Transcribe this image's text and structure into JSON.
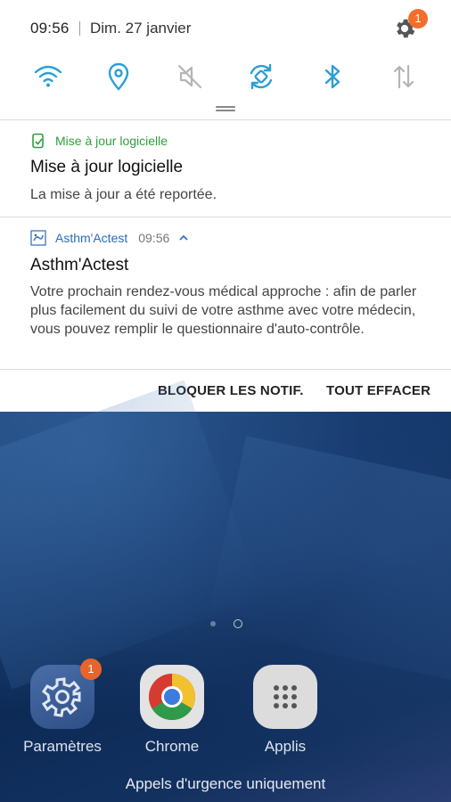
{
  "status_bar": {
    "time": "09:56",
    "date": "Dim. 27 janvier",
    "settings_badge": "1"
  },
  "quick_settings": [
    {
      "name": "wifi",
      "icon": "wifi-icon",
      "active": true
    },
    {
      "name": "location",
      "icon": "location-icon",
      "active": true
    },
    {
      "name": "sound",
      "icon": "mute-icon",
      "active": false
    },
    {
      "name": "auto-rotate",
      "icon": "rotate-icon",
      "active": true
    },
    {
      "name": "bluetooth",
      "icon": "bluetooth-icon",
      "active": true
    },
    {
      "name": "mobile-data",
      "icon": "data-transfer-icon",
      "active": false
    }
  ],
  "notifications": [
    {
      "app": "Mise à jour logicielle",
      "title": "Mise à jour logicielle",
      "text": "La mise à jour a été reportée."
    },
    {
      "app": "Asthm'Actest",
      "time": "09:56",
      "title": "Asthm'Actest",
      "text": "Votre prochain rendez-vous médical approche : afin de parler plus facilement du suivi de votre asthme avec votre médecin, vous pouvez remplir le questionnaire d'auto-contrôle."
    }
  ],
  "actions": {
    "block": "BLOQUER LES NOTIF.",
    "clear": "TOUT EFFACER"
  },
  "home": {
    "apps": [
      {
        "label": "Paramètres",
        "badge": "1"
      },
      {
        "label": "Chrome"
      },
      {
        "label": "Applis"
      }
    ],
    "emergency": "Appels d'urgence uniquement"
  },
  "colors": {
    "accent": "#2a9fd6",
    "inactive": "#b5b5b5",
    "badge": "#f36e2a"
  }
}
